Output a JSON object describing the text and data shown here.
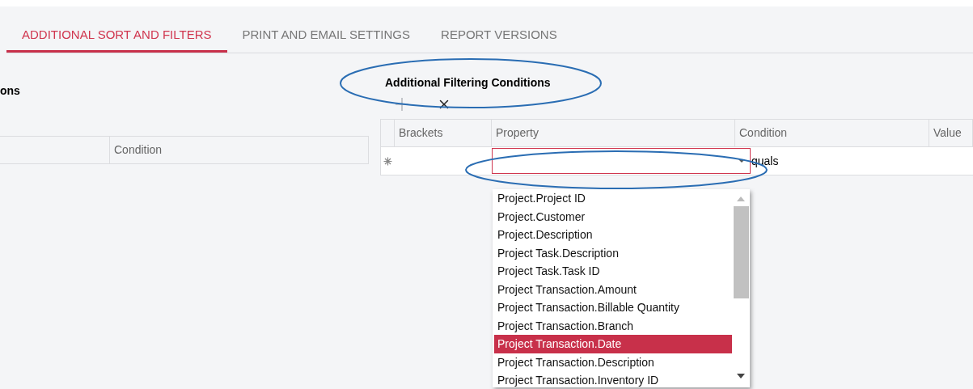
{
  "tabs": [
    {
      "label": "ADDITIONAL SORT AND FILTERS",
      "selected": true
    },
    {
      "label": "PRINT AND EMAIL SETTINGS",
      "selected": false
    },
    {
      "label": "REPORT VERSIONS",
      "selected": false
    }
  ],
  "left_panel": {
    "title": "ons",
    "columns": [
      "Condition"
    ]
  },
  "filter_panel": {
    "title": "Additional Filtering Conditions",
    "toolbar": [
      {
        "kind": "add",
        "disabled": true
      },
      {
        "kind": "delete",
        "disabled": false
      }
    ],
    "columns": [
      "Brackets",
      "Property",
      "Condition",
      "Value"
    ],
    "new_row": {
      "condition": "quals"
    },
    "dropdown": [
      {
        "label": "Project.Project ID",
        "selected": false
      },
      {
        "label": "Project.Customer",
        "selected": false
      },
      {
        "label": "Project.Description",
        "selected": false
      },
      {
        "label": "Project Task.Description",
        "selected": false
      },
      {
        "label": "Project Task.Task ID",
        "selected": false
      },
      {
        "label": "Project Transaction.Amount",
        "selected": false
      },
      {
        "label": "Project Transaction.Billable Quantity",
        "selected": false
      },
      {
        "label": "Project Transaction.Branch",
        "selected": false
      },
      {
        "label": "Project Transaction.Date",
        "selected": true
      },
      {
        "label": "Project Transaction.Description",
        "selected": false
      },
      {
        "label": "Project Transaction.Inventory ID",
        "selected": false
      }
    ]
  }
}
